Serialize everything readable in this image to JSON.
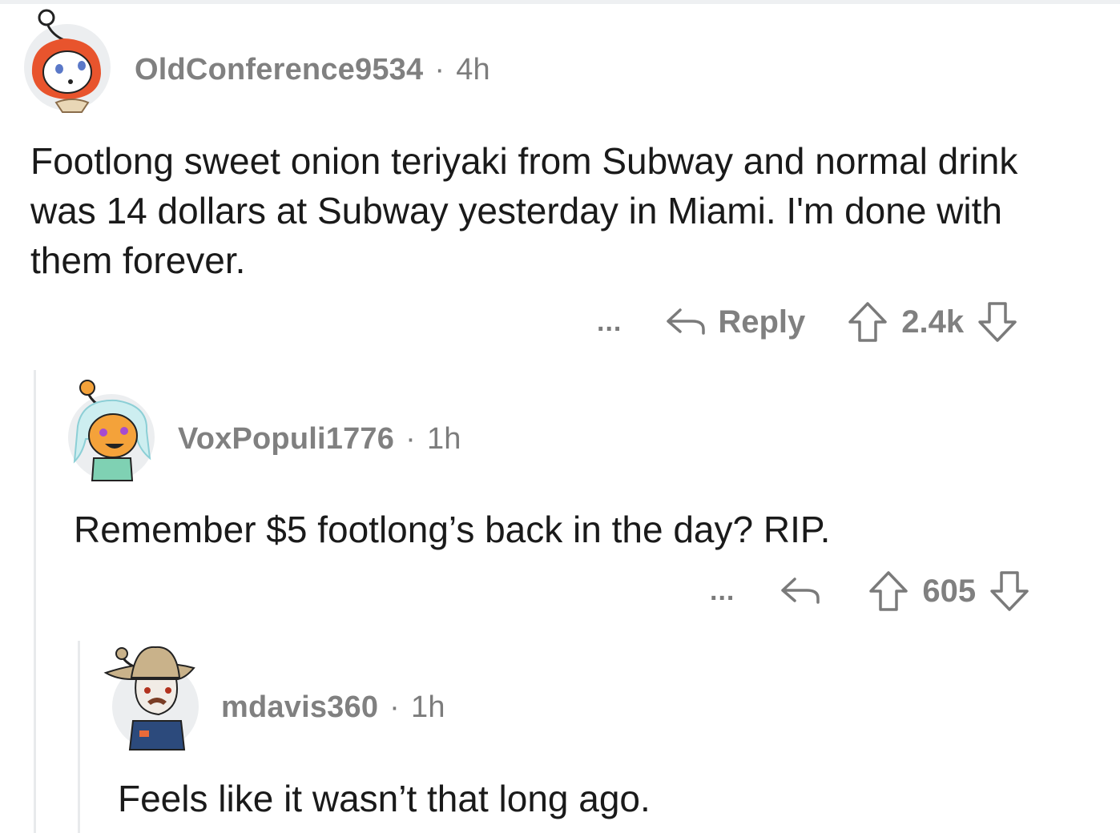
{
  "comments": [
    {
      "username": "OldConference9534",
      "separator": "·",
      "age": "4h",
      "body": "Footlong sweet onion teriyaki from Subway and normal drink was 14 dollars at Subway yesterday in Miami. I'm done with them forever.",
      "more": "...",
      "reply_label": "Reply",
      "score": "2.4k"
    },
    {
      "username": "VoxPopuli1776",
      "separator": "·",
      "age": "1h",
      "body": "Remember $5 footlong’s back in the day? RIP.",
      "more": "...",
      "score": "605"
    },
    {
      "username": "mdavis360",
      "separator": "·",
      "age": "1h",
      "body": "Feels like it wasn’t that long ago."
    }
  ],
  "icons": {
    "reply": "reply-arrow-icon",
    "upvote": "upvote-arrow-icon",
    "downvote": "downvote-arrow-icon",
    "more": "more-options-icon"
  },
  "colors": {
    "meta_text": "#7c7c7c",
    "body_text": "#1a1a1a",
    "thread_line": "#e8eaec",
    "avatar1_accent": "#e8542d",
    "avatar2_accent": "#f4a23a",
    "avatar3_accent": "#c9b28a"
  }
}
